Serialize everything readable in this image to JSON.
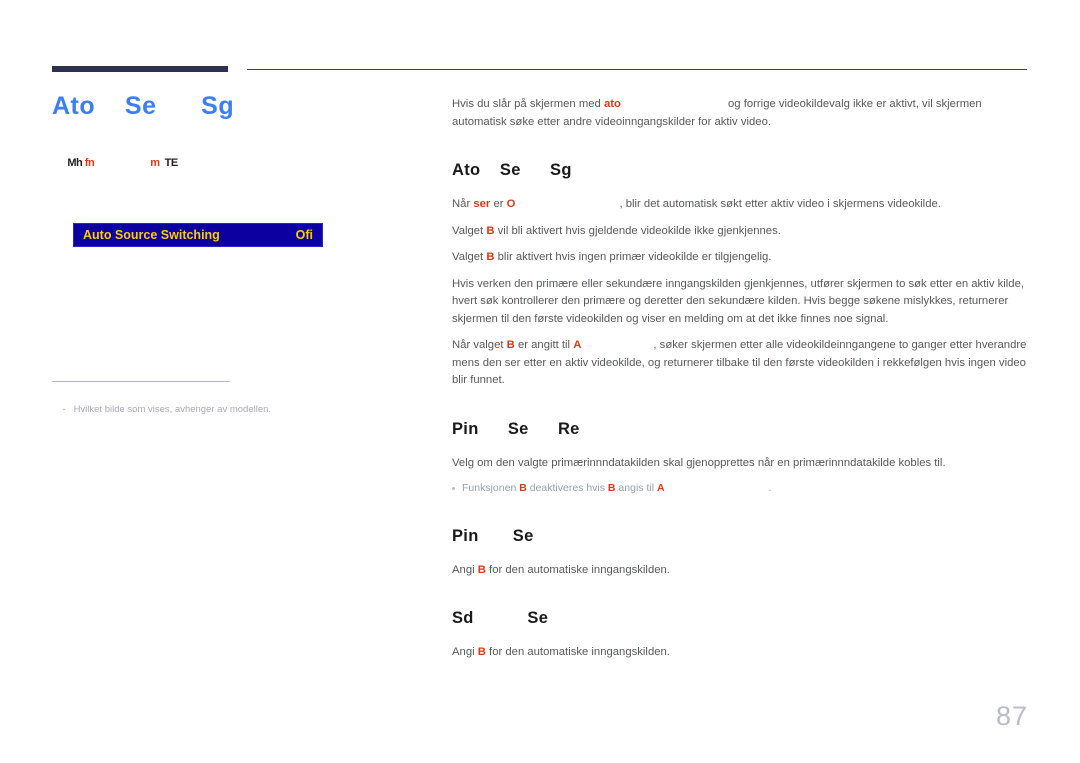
{
  "document": {
    "page_number": "87"
  },
  "left_column": {
    "title": "Ato    Se      Sg",
    "breadcrumb": {
      "menu_label": "Mh",
      "item_1": "fn",
      "item_2": "m",
      "item_3": "TE"
    },
    "osd": {
      "label": "Auto Source Switching",
      "value": "Ofi",
      "bar_color": "#0d00a0",
      "text_color": "#ffcc00"
    },
    "footnote": {
      "dash": "-",
      "text": "Hvilket bilde som vises, avhenger av modellen."
    },
    "title_color": "#3d7ff0"
  },
  "right_column": {
    "intro": {
      "part_1": "Hvis du slår på skjermen med ",
      "keyword_1": "ato",
      "part_2": " og forrige videokildevalg ikke er aktivt, vil skjermen automatisk søke etter andre videoinngangskilder for aktiv video."
    },
    "sections": [
      {
        "heading": "Ato    Se      Sg",
        "paragraphs": [
          {
            "part_1": "Når ",
            "keyword_1": "ser",
            "part_1b": " er ",
            "keyword_1b": "O",
            "part_2": ", blir det automatisk søkt etter aktiv video i skjermens videokilde."
          },
          {
            "part_1": "Valget ",
            "keyword_1": "B",
            "part_2": " vil bli aktivert hvis gjeldende videokilde ikke gjenkjennes."
          },
          {
            "part_1": "Valget ",
            "keyword_1": "B",
            "part_2": " blir aktivert hvis ingen primær videokilde er tilgjengelig."
          },
          {
            "part_1": "Hvis verken den primære eller sekundære inngangskilden gjenkjennes, utfører skjermen to søk etter en aktiv kilde, hvert søk kontrollerer den primære og deretter den sekundære kilden. Hvis begge søkene mislykkes, returnerer skjermen til den første videokilden og viser en melding om at det ikke finnes noe signal."
          },
          {
            "part_1": "Når valget ",
            "keyword_1": "B",
            "part_1b": " er angitt til ",
            "keyword_1b": "A",
            "part_2": ", søker skjermen etter alle videokildeinngangene to ganger etter hverandre mens den ser etter en aktiv videokilde, og returnerer tilbake til den første videokilden i rekkefølgen hvis ingen video blir funnet."
          }
        ]
      },
      {
        "heading": "Pin      Se      Re",
        "paragraphs": [
          {
            "part_1": "Velg om den valgte primærinnndatakilden skal gjenopprettes når en primærinnndatakilde kobles til."
          }
        ],
        "bullet": {
          "part_1": "Funksjonen ",
          "keyword_1": "B",
          "part_1b": " deaktiveres hvis ",
          "keyword_1b": "B",
          "part_1c": " angis til ",
          "keyword_1c": "A",
          "part_2": "."
        }
      },
      {
        "heading": "Pin       Se",
        "paragraphs": [
          {
            "part_1": "Angi ",
            "keyword_1": "B",
            "part_2": " for den automatiske inngangskilden."
          }
        ]
      },
      {
        "heading": "Sd           Se",
        "paragraphs": [
          {
            "part_1": "Angi ",
            "keyword_1": "B",
            "part_2": " for den automatiske inngangskilden."
          }
        ]
      }
    ]
  }
}
